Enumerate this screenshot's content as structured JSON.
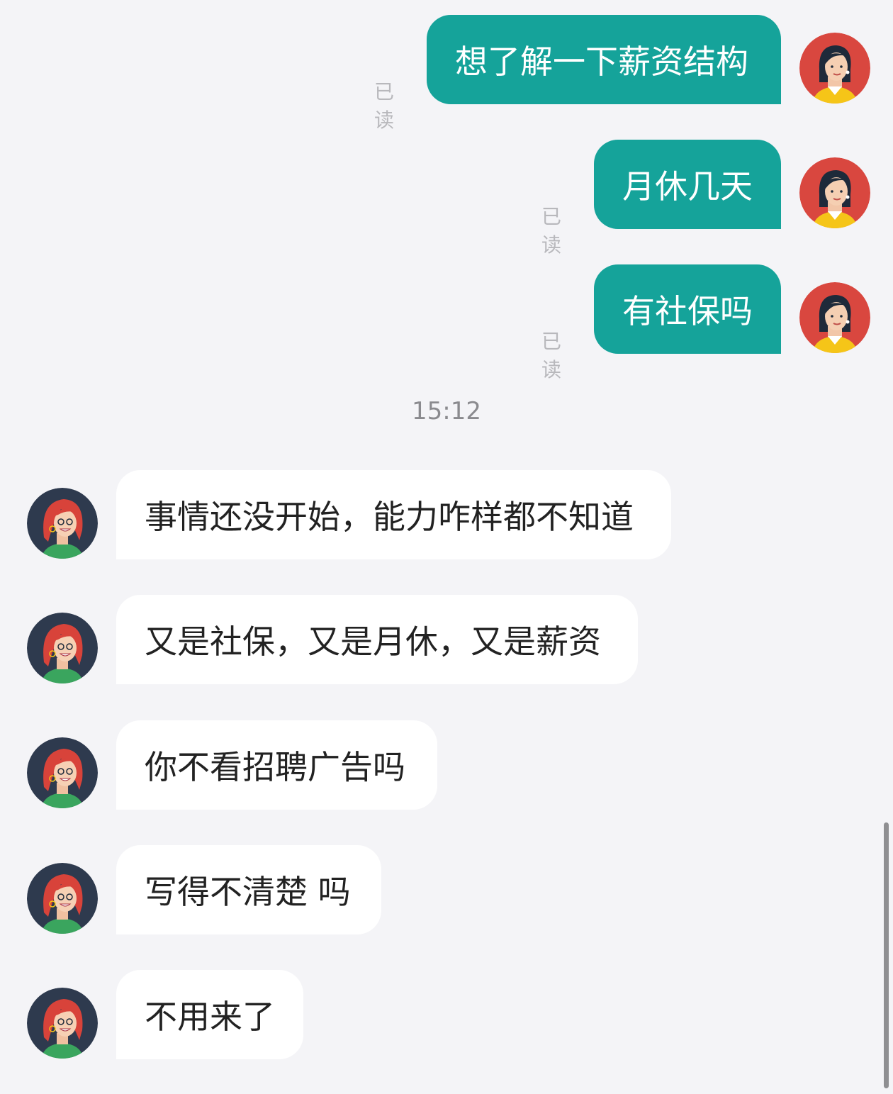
{
  "outgoing": [
    {
      "text": "想了解一下薪资结构",
      "read_label": "已读"
    },
    {
      "text": "月休几天",
      "read_label": "已读"
    },
    {
      "text": "有社保吗",
      "read_label": "已读"
    }
  ],
  "timestamp": "15:12",
  "incoming": [
    {
      "text": "事情还没开始，能力咋样都不知道"
    },
    {
      "text": "又是社保，又是月休，又是薪资"
    },
    {
      "text": "你不看招聘广告吗"
    },
    {
      "text": "写得不清楚 吗"
    },
    {
      "text": "不用来了"
    }
  ],
  "icons": {
    "self_avatar": "woman-avatar-black-hair-icon",
    "other_avatar": "woman-avatar-red-hair-icon"
  },
  "colors": {
    "outgoing_bubble": "#15a39a",
    "incoming_bubble": "#ffffff",
    "background": "#f4f4f7"
  }
}
